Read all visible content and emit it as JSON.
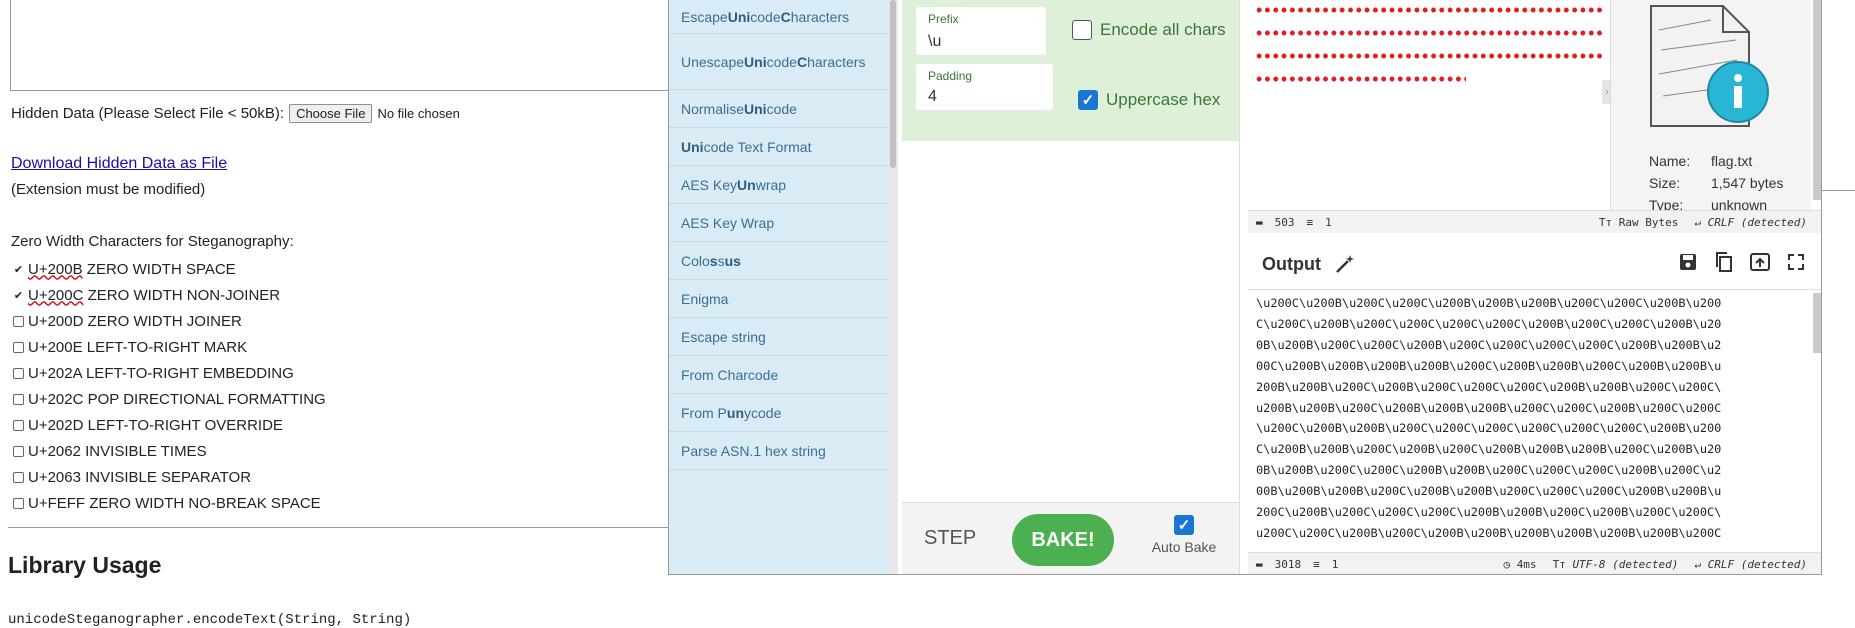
{
  "page": {
    "hidden_label": "Hidden Data (Please Select File < 50kB):",
    "choose_file": "Choose File",
    "no_file": "No file chosen",
    "download_link": "Download Hidden Data as File",
    "ext_note": "(Extension must be modified)",
    "zw_title": "Zero Width Characters for Steganography:",
    "zw_items": [
      {
        "code": "U+200B",
        "label": "ZERO WIDTH SPACE",
        "checked": true
      },
      {
        "code": "U+200C",
        "label": "ZERO WIDTH NON-JOINER",
        "checked": true
      },
      {
        "code": "U+200D",
        "label": "ZERO WIDTH JOINER",
        "checked": false
      },
      {
        "code": "U+200E",
        "label": "LEFT-TO-RIGHT MARK",
        "checked": false
      },
      {
        "code": "U+202A",
        "label": "LEFT-TO-RIGHT EMBEDDING",
        "checked": false
      },
      {
        "code": "U+202C",
        "label": "POP DIRECTIONAL FORMATTING",
        "checked": false
      },
      {
        "code": "U+202D",
        "label": "LEFT-TO-RIGHT OVERRIDE",
        "checked": false
      },
      {
        "code": "U+2062",
        "label": "INVISIBLE TIMES",
        "checked": false
      },
      {
        "code": "U+2063",
        "label": "INVISIBLE SEPARATOR",
        "checked": false
      },
      {
        "code": "U+FEFF",
        "label": "ZERO WIDTH NO-BREAK SPACE",
        "checked": false
      }
    ],
    "library_title": "Library Usage",
    "code_line": "unicodeSteganographer.encodeText(String, String)"
  },
  "operations": [
    {
      "html": "Escape <b>Uni</b>code <b>C</b>haracters"
    },
    {
      "html": "Unescape <b>Uni</b>code<br><b>C</b>haracters"
    },
    {
      "html": "Normalise <b>Uni</b>code"
    },
    {
      "html": "<b>Uni</b>code Text Format"
    },
    {
      "html": "AES Key <b>Un</b>wrap"
    },
    {
      "html": "AES Key Wrap"
    },
    {
      "html": "Colo<b>s</b>s<b>us</b>"
    },
    {
      "html": "Enigma"
    },
    {
      "html": "Escape string"
    },
    {
      "html": "From Charcode"
    },
    {
      "html": "From P<b>un</b>ycode"
    },
    {
      "html": "Parse ASN.1 hex string"
    }
  ],
  "recipe": {
    "prefix_label": "Prefix",
    "prefix_value": "\\u",
    "encode_all_label": "Encode all chars",
    "encode_all_checked": false,
    "padding_label": "Padding",
    "padding_value": "4",
    "uppercase_label": "Uppercase hex",
    "uppercase_checked": true,
    "step_label": "STEP",
    "bake_label": "BAKE!",
    "auto_bake_label": "Auto Bake"
  },
  "input": {
    "file_name_label": "Name:",
    "file_name": "flag.txt",
    "size_label": "Size:",
    "size": "1,547 bytes",
    "type_label": "Type:",
    "type": "unknown",
    "length": "503",
    "lines": "1",
    "raw_bytes": "Raw Bytes",
    "eol": "CRLF (detected)"
  },
  "output": {
    "title": "Output",
    "lines": [
      "\\u200C\\u200B\\u200C\\u200C\\u200B\\u200B\\u200B\\u200C\\u200C\\u200B\\u200",
      "C\\u200C\\u200B\\u200C\\u200C\\u200C\\u200C\\u200B\\u200C\\u200C\\u200B\\u20",
      "0B\\u200B\\u200C\\u200C\\u200B\\u200C\\u200C\\u200C\\u200C\\u200B\\u200B\\u2",
      "00C\\u200B\\u200B\\u200B\\u200B\\u200C\\u200B\\u200B\\u200C\\u200B\\u200B\\u",
      "200B\\u200B\\u200C\\u200B\\u200C\\u200C\\u200C\\u200B\\u200B\\u200C\\u200C\\",
      "u200B\\u200B\\u200C\\u200B\\u200B\\u200B\\u200C\\u200C\\u200B\\u200C\\u200C",
      "\\u200C\\u200B\\u200B\\u200C\\u200C\\u200C\\u200C\\u200C\\u200C\\u200B\\u200",
      "C\\u200B\\u200B\\u200C\\u200B\\u200C\\u200B\\u200B\\u200B\\u200C\\u200B\\u20",
      "0B\\u200B\\u200C\\u200C\\u200B\\u200B\\u200C\\u200C\\u200C\\u200B\\u200C\\u2",
      "00B\\u200B\\u200B\\u200C\\u200B\\u200B\\u200C\\u200C\\u200C\\u200B\\u200B\\u",
      "200C\\u200B\\u200C\\u200C\\u200C\\u200B\\u200B\\u200C\\u200B\\u200C\\u200C\\",
      "u200C\\u200C\\u200B\\u200C\\u200B\\u200B\\u200B\\u200B\\u200B\\u200B\\u200C"
    ],
    "length": "3018",
    "lines_count": "1",
    "time": "4ms",
    "encoding": "UTF-8 (detected)",
    "eol": "CRLF (detected)"
  },
  "colors": {
    "ops_bg": "#d9ecf5",
    "recipe_bg": "#dff0d8",
    "bake": "#4caf50",
    "dots": "#e02020"
  }
}
